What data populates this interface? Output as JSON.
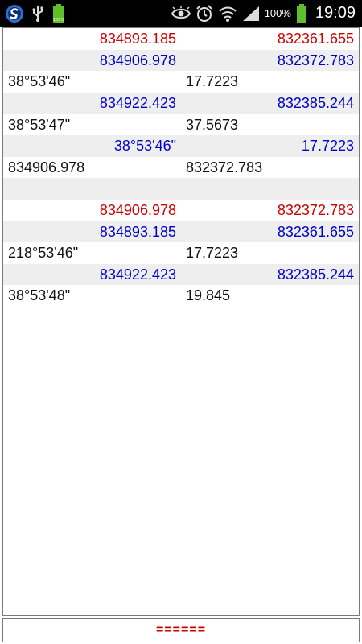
{
  "status_bar": {
    "battery_percent_text": "100%",
    "time": "19:09",
    "small_battery_label": "100%",
    "icons": [
      "sync-app-icon",
      "usb-icon",
      "battery-small-icon",
      "eye-icon",
      "alarm-icon",
      "wifi-icon",
      "signal-icon",
      "battery-icon"
    ],
    "colors": {
      "background": "#000000",
      "battery_green": "#5fbf2a",
      "sync_blue": "#2b6fd6"
    }
  },
  "rows": [
    {
      "shaded": false,
      "cells": [
        {
          "text": "834893.185",
          "color": "red",
          "align": "right"
        },
        {
          "text": "832361.655",
          "color": "red",
          "align": "right"
        }
      ]
    },
    {
      "shaded": true,
      "cells": [
        {
          "text": "834906.978",
          "color": "blue",
          "align": "right"
        },
        {
          "text": "832372.783",
          "color": "blue",
          "align": "right"
        }
      ]
    },
    {
      "shaded": false,
      "cells": [
        {
          "text": "38°53'46\"",
          "color": "black",
          "align": "left"
        },
        {
          "text": "17.7223",
          "color": "black",
          "align": "left"
        }
      ]
    },
    {
      "shaded": true,
      "cells": [
        {
          "text": "834922.423",
          "color": "blue",
          "align": "right"
        },
        {
          "text": "832385.244",
          "color": "blue",
          "align": "right"
        }
      ]
    },
    {
      "shaded": false,
      "cells": [
        {
          "text": "38°53'47\"",
          "color": "black",
          "align": "left"
        },
        {
          "text": "37.5673",
          "color": "black",
          "align": "left"
        }
      ]
    },
    {
      "shaded": true,
      "cells": [
        {
          "text": "38°53'46\"",
          "color": "blue",
          "align": "right"
        },
        {
          "text": "17.7223",
          "color": "blue",
          "align": "right"
        }
      ]
    },
    {
      "shaded": false,
      "cells": [
        {
          "text": "834906.978",
          "color": "black",
          "align": "left"
        },
        {
          "text": "832372.783",
          "color": "black",
          "align": "left"
        }
      ]
    },
    {
      "shaded": true,
      "cells": [
        {
          "text": "",
          "color": "black",
          "align": "left"
        },
        {
          "text": "",
          "color": "black",
          "align": "left"
        }
      ]
    },
    {
      "shaded": false,
      "cells": [
        {
          "text": "834906.978",
          "color": "red",
          "align": "right"
        },
        {
          "text": "832372.783",
          "color": "red",
          "align": "right"
        }
      ]
    },
    {
      "shaded": true,
      "cells": [
        {
          "text": "834893.185",
          "color": "blue",
          "align": "right"
        },
        {
          "text": "832361.655",
          "color": "blue",
          "align": "right"
        }
      ]
    },
    {
      "shaded": false,
      "cells": [
        {
          "text": "218°53'46\"",
          "color": "black",
          "align": "left"
        },
        {
          "text": "17.7223",
          "color": "black",
          "align": "left"
        }
      ]
    },
    {
      "shaded": true,
      "cells": [
        {
          "text": "834922.423",
          "color": "blue",
          "align": "right"
        },
        {
          "text": "832385.244",
          "color": "blue",
          "align": "right"
        }
      ]
    },
    {
      "shaded": false,
      "cells": [
        {
          "text": "38°53'48\"",
          "color": "black",
          "align": "left"
        },
        {
          "text": "19.845",
          "color": "black",
          "align": "left"
        }
      ]
    }
  ],
  "bottom_bar": {
    "text": "======",
    "color": "#cc0000"
  }
}
